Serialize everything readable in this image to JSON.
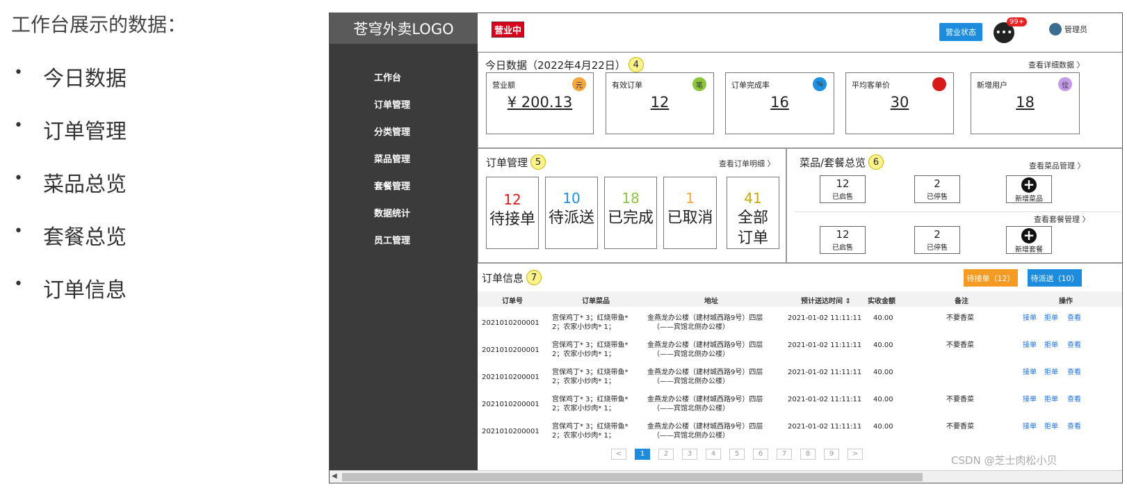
{
  "slide": {
    "title": "工作台展示的数据：",
    "bullets": [
      "今日数据",
      "订单管理",
      "菜品总览",
      "套餐总览",
      "订单信息"
    ]
  },
  "sidebar": {
    "logo": "苍穹外卖LOGO",
    "items": [
      "工作台",
      "订单管理",
      "分类管理",
      "菜品管理",
      "套餐管理",
      "数据统计",
      "员工管理"
    ]
  },
  "topbar": {
    "status": "营业中",
    "status_button": "营业状态",
    "msg_icon": "chat-icon",
    "msg_badge": "99+",
    "user": "管理员"
  },
  "today": {
    "title": "今日数据（2022年4月22日）",
    "num": "4",
    "more": "查看详细数据 〉",
    "stats": [
      {
        "label": "营业额",
        "value": "¥ 200.13",
        "icon": "元",
        "color": "#f5a63c"
      },
      {
        "label": "有效订单",
        "value": "12",
        "icon": "笔",
        "color": "#8cc63f"
      },
      {
        "label": "订单完成率",
        "value": "16",
        "icon": "%",
        "color": "#1e90e0"
      },
      {
        "label": "平均客单价",
        "value": "30",
        "icon": "",
        "color": "#d61a1a"
      },
      {
        "label": "新增用户",
        "value": "18",
        "icon": "位",
        "color": "#c49be8"
      }
    ]
  },
  "orders": {
    "title": "订单管理",
    "num": "5",
    "more": "查看订单明细 〉",
    "cards": [
      {
        "num": "12",
        "label": "待接单",
        "color": "#d61a1a"
      },
      {
        "num": "10",
        "label": "待派送",
        "color": "#1e90e0"
      },
      {
        "num": "18",
        "label": "已完成",
        "color": "#8cc63f"
      },
      {
        "num": "1",
        "label": "已取消",
        "color": "#f5a63c"
      },
      {
        "num": "41",
        "label": "全部订单",
        "color": "#c8a800"
      }
    ]
  },
  "dishes": {
    "title": "菜品/套餐总览",
    "num": "6",
    "more_dish": "查看菜品管理 〉",
    "more_setmeal": "查看套餐管理 〉",
    "dish_on": {
      "num": "12",
      "label": "已启售"
    },
    "dish_off": {
      "num": "2",
      "label": "已停售"
    },
    "dish_add": "新增菜品",
    "set_on": {
      "num": "12",
      "label": "已启售"
    },
    "set_off": {
      "num": "2",
      "label": "已停售"
    },
    "set_add": "新增套餐"
  },
  "info": {
    "title": "订单信息",
    "num": "7",
    "btn_pending": "待接单（12）",
    "btn_delivery": "待派送（10）",
    "headers": [
      "订单号",
      "订单菜品",
      "地址",
      "预计送达时间 ⇕",
      "实收金额",
      "备注",
      "操作"
    ],
    "rows": [
      {
        "id": "2021010200001",
        "dish1": "宫保鸡丁* 3；红烧带鱼*",
        "dish2": "2；农家小炒肉* 1；",
        "addr1": "金燕龙办公楼（建材城西路9号）四层",
        "addr2": "（——宾馆北侧办公楼）",
        "time": "2021-01-02 11:11:11",
        "amount": "40.00",
        "note": "不要香菜"
      },
      {
        "id": "2021010200001",
        "dish1": "宫保鸡丁* 3；红烧带鱼*",
        "dish2": "2；农家小炒肉* 1；",
        "addr1": "金燕龙办公楼（建材城西路9号）四层",
        "addr2": "（——宾馆北侧办公楼）",
        "time": "2021-01-02 11:11:11",
        "amount": "40.00",
        "note": "不要香菜"
      },
      {
        "id": "2021010200001",
        "dish1": "宫保鸡丁* 3；红烧带鱼*",
        "dish2": "2；农家小炒肉* 1；",
        "addr1": "金燕龙办公楼（建材城西路9号）四层",
        "addr2": "（——宾馆北侧办公楼）",
        "time": "2021-01-02 11:11:11",
        "amount": "40.00",
        "note": ""
      },
      {
        "id": "2021010200001",
        "dish1": "宫保鸡丁* 3；红烧带鱼*",
        "dish2": "2；农家小炒肉* 1；",
        "addr1": "金燕龙办公楼（建材城西路9号）四层",
        "addr2": "（——宾馆北侧办公楼）",
        "time": "2021-01-02 11:11:11",
        "amount": "40.00",
        "note": "不要香菜"
      },
      {
        "id": "2021010200001",
        "dish1": "宫保鸡丁* 3；红烧带鱼*",
        "dish2": "2；农家小炒肉* 1；",
        "addr1": "金燕龙办公楼（建材城西路9号）四层",
        "addr2": "（——宾馆北侧办公楼）",
        "time": "2021-01-02 11:11:11",
        "amount": "40.00",
        "note": "不要香菜"
      }
    ],
    "actions": [
      "接单",
      "拒单",
      "查看"
    ],
    "pages": [
      "<",
      "1",
      "2",
      "3",
      "4",
      "5",
      "6",
      "7",
      "8",
      "9",
      ">"
    ]
  },
  "watermark": "CSDN @芝士肉松小贝"
}
